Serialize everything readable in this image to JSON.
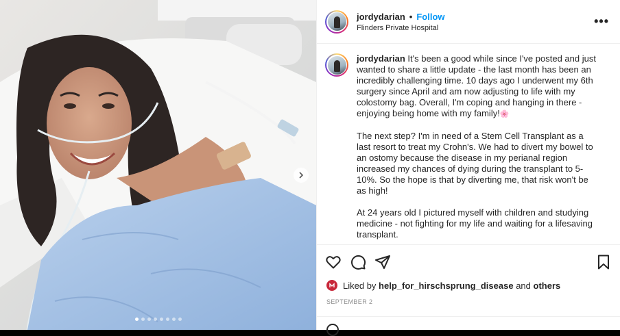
{
  "post": {
    "username": "jordydarian",
    "separator": "•",
    "follow_label": "Follow",
    "location": "Flinders Private Hospital",
    "more_label": "•••"
  },
  "caption": {
    "username": "jordydarian",
    "paragraph_1": "It's been a good while since I've posted and just wanted to share a little update - the last month has been an incredibly challenging time. 10 days ago I underwent my 6th surgery since April and am now adjusting to life with my colostomy bag. Overall, I'm coping and hanging in there - enjoying being home with my family!",
    "paragraph_1_emoji": "🌸",
    "paragraph_2": "The next step? I'm in need of a Stem Cell Transplant as a last resort to treat my Crohn's. We had to divert my bowel to an ostomy because the disease in my perianal region increased my chances of dying during the transplant to 5-10%. So the hope is that by diverting me, that risk won't be as high!",
    "paragraph_3": "At 24 years old I pictured myself with children and studying medicine - not fighting for my life and waiting for a lifesaving transplant."
  },
  "likes": {
    "prefix": "Liked by",
    "liker": "help_for_hirschsprung_disease",
    "conjunction": "and",
    "others": "others"
  },
  "date": "SEPTEMBER 2",
  "carousel": {
    "count": 8,
    "active_index": 0
  },
  "icons": {
    "like": "heart-icon",
    "comment": "comment-icon",
    "share": "send-icon",
    "save": "bookmark-icon",
    "next": "chevron-right-icon"
  },
  "colors": {
    "follow": "#0095f6",
    "text": "#262626",
    "muted": "#8e8e8e"
  }
}
